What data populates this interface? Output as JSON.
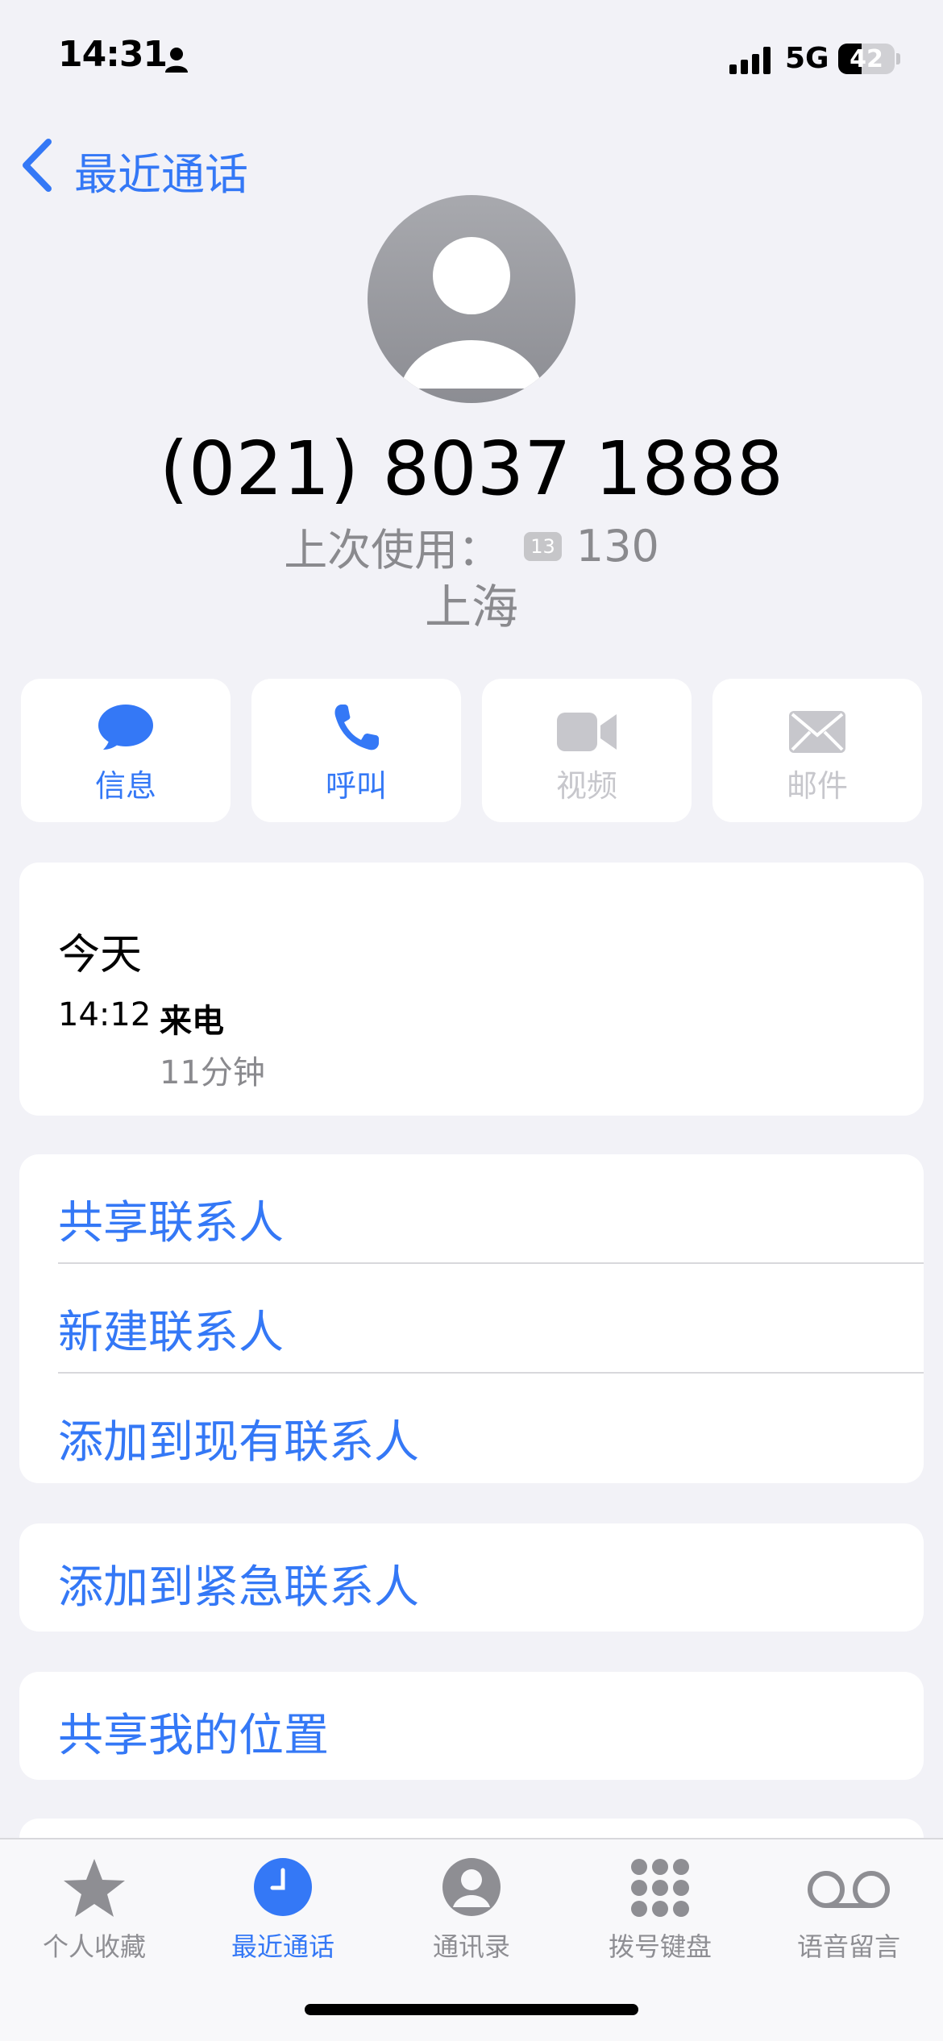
{
  "status_bar": {
    "time": "14:31",
    "network": "5G",
    "battery_level": "42",
    "battery_fraction": 0.42
  },
  "nav": {
    "back_label": "最近通话"
  },
  "contact": {
    "phone_number": "(021) 8037 1888",
    "last_used_label": "上次使用：",
    "sim_badge": "13",
    "last_used_value": "130",
    "location": "上海"
  },
  "actions": [
    {
      "label": "信息",
      "icon": "message-icon",
      "enabled": true
    },
    {
      "label": "呼叫",
      "icon": "phone-icon",
      "enabled": true
    },
    {
      "label": "视频",
      "icon": "video-icon",
      "enabled": false
    },
    {
      "label": "邮件",
      "icon": "mail-icon",
      "enabled": false
    }
  ],
  "recent": {
    "day": "今天",
    "time": "14:12",
    "type": "来电",
    "duration": "11分钟"
  },
  "contact_options": [
    "共享联系人",
    "新建联系人",
    "添加到现有联系人"
  ],
  "emergency_option": "添加到紧急联系人",
  "location_option": "共享我的位置",
  "tabs": [
    {
      "label": "个人收藏",
      "icon": "star-icon",
      "active": false
    },
    {
      "label": "最近通话",
      "icon": "clock-icon",
      "active": true
    },
    {
      "label": "通讯录",
      "icon": "contacts-icon",
      "active": false
    },
    {
      "label": "拨号键盘",
      "icon": "keypad-icon",
      "active": false
    },
    {
      "label": "语音留言",
      "icon": "voicemail-icon",
      "active": false
    }
  ],
  "colors": {
    "accent": "#3478f6",
    "background": "#f2f2f7",
    "secondary_text": "#8a8a8e",
    "disabled": "#c7c7cc"
  }
}
